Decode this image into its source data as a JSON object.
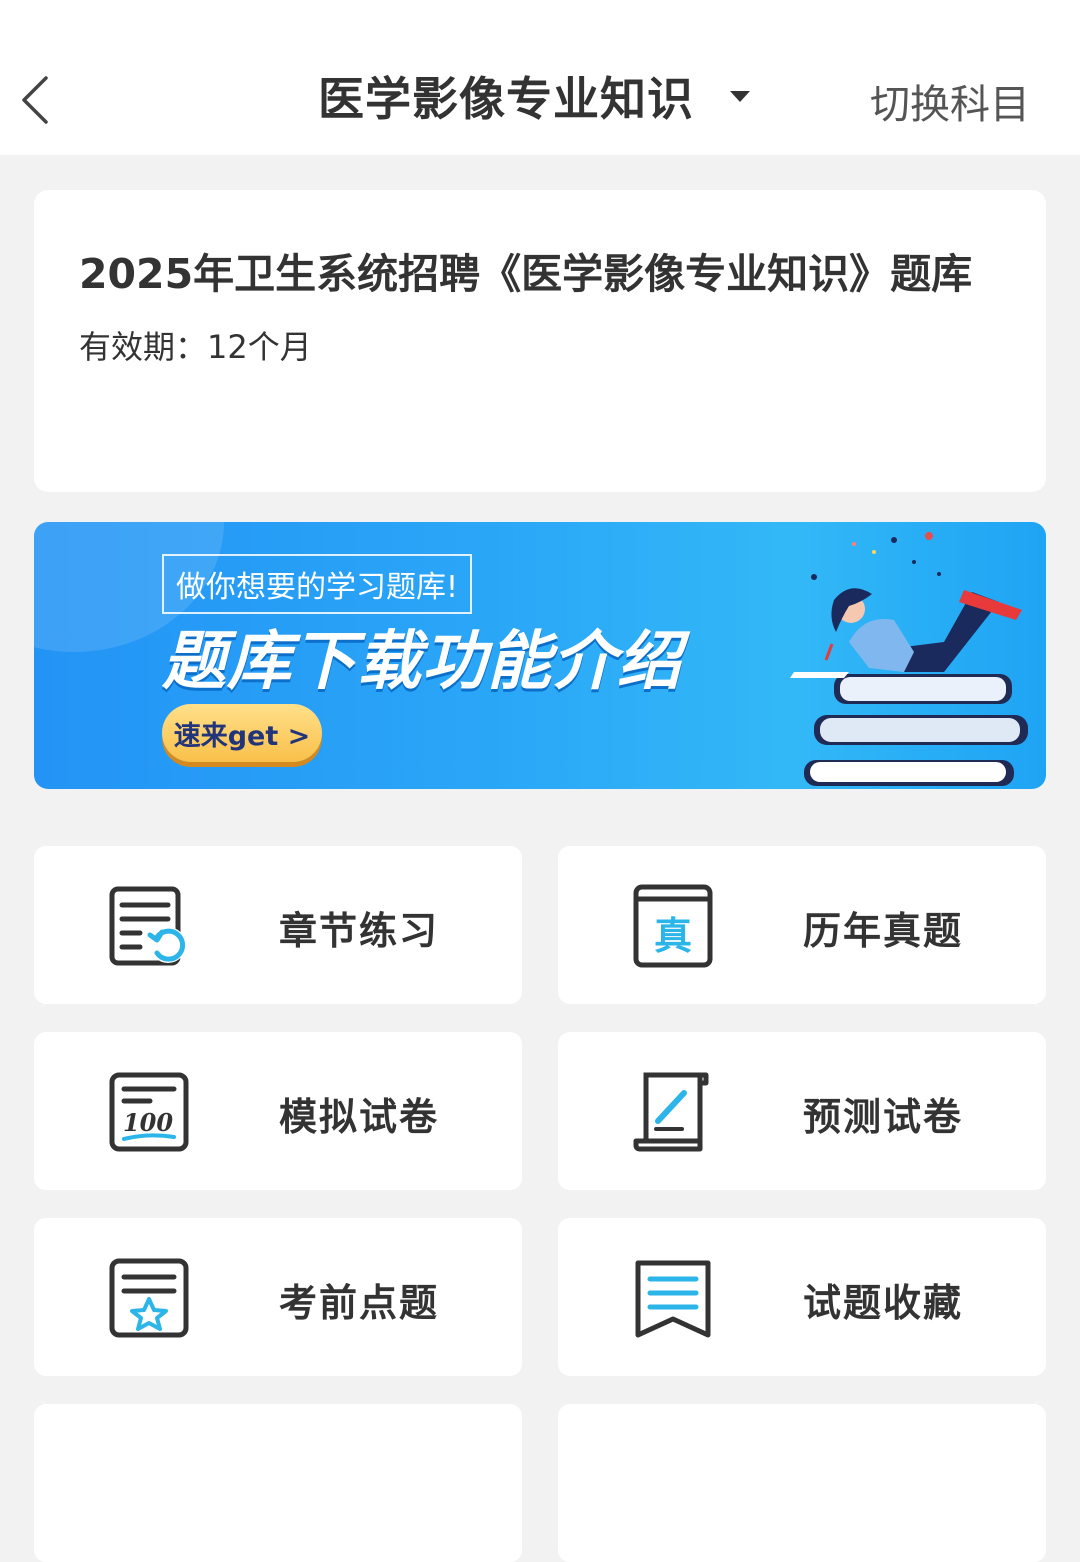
{
  "header": {
    "title": "医学影像专业知识",
    "switch_label": "切换科目"
  },
  "course_card": {
    "title": "2025年卫生系统招聘《医学影像专业知识》题库",
    "validity": "有效期：12个月"
  },
  "banner": {
    "slogan": "做你想要的学习题库!",
    "headline": "题库下载功能介绍",
    "cta": "速来get >"
  },
  "menu": [
    {
      "label": "章节练习",
      "icon": "chapter-practice-icon"
    },
    {
      "label": "历年真题",
      "icon": "past-exam-icon"
    },
    {
      "label": "模拟试卷",
      "icon": "mock-exam-icon"
    },
    {
      "label": "预测试卷",
      "icon": "prediction-exam-icon"
    },
    {
      "label": "考前点题",
      "icon": "key-points-icon"
    },
    {
      "label": "试题收藏",
      "icon": "favorites-icon"
    }
  ],
  "colors": {
    "accent": "#2bb5e8",
    "icon_stroke": "#333333",
    "banner_blue": "#2394f5",
    "cta_yellow": "#f9c04a"
  }
}
